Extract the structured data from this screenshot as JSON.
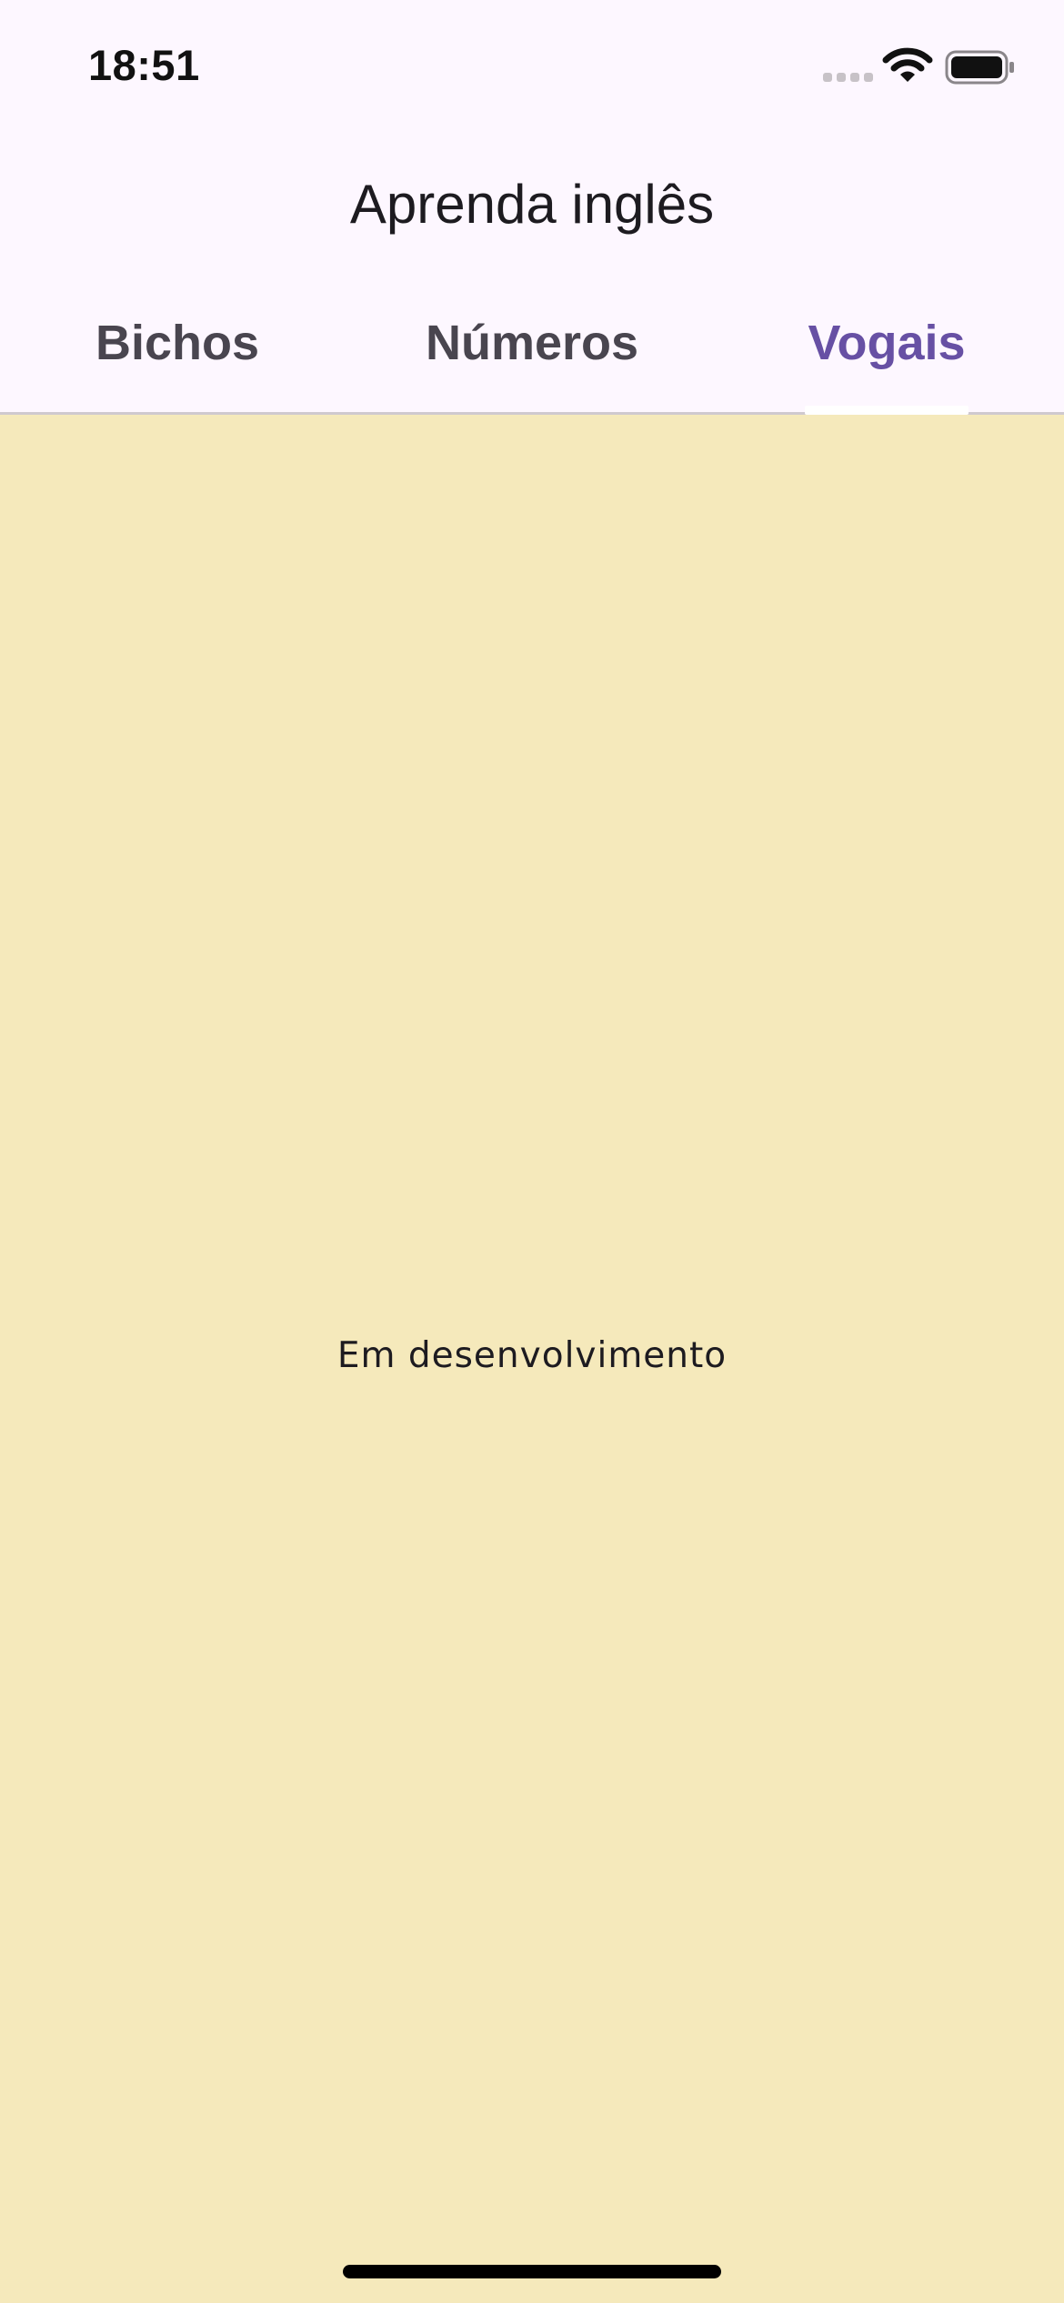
{
  "status_bar": {
    "time": "18:51",
    "icons": [
      "cellular-signal-icon",
      "wifi-icon",
      "battery-icon"
    ]
  },
  "app_bar": {
    "title": "Aprenda inglês"
  },
  "tabs": [
    {
      "label": "Bichos",
      "selected": false
    },
    {
      "label": "Números",
      "selected": false
    },
    {
      "label": "Vogais",
      "selected": true
    }
  ],
  "content": {
    "message": "Em desenvolvimento"
  },
  "colors": {
    "header_background": "#fdf7ff",
    "content_background": "#f5e9bb",
    "tab_active": "#6750a4",
    "tab_inactive": "#49454f",
    "text": "#1d1b20"
  }
}
